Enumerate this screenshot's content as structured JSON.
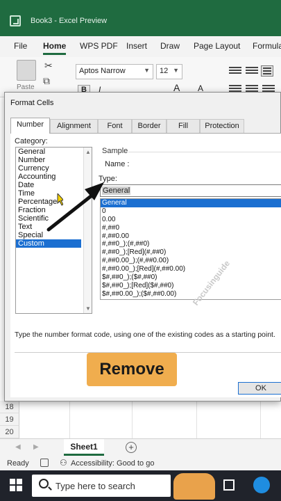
{
  "window": {
    "title": "Book3 - Excel Preview"
  },
  "ribbon_tabs": [
    "File",
    "Home",
    "WPS PDF",
    "Insert",
    "Draw",
    "Page Layout",
    "Formula"
  ],
  "ribbon": {
    "paste_label": "Paste",
    "font_name": "Aptos Narrow",
    "font_size": "12",
    "bold": "B",
    "italic": "I",
    "grow_font": "A",
    "shrink_font": "A"
  },
  "dialog": {
    "title": "Format Cells",
    "tabs": [
      "Number",
      "Alignment",
      "Font",
      "Border",
      "Fill",
      "Protection"
    ],
    "category_label": "Category:",
    "categories": [
      "General",
      "Number",
      "Currency",
      "Accounting",
      "Date",
      "Time",
      "Percentage",
      "Fraction",
      "Scientific",
      "Text",
      "Special",
      "Custom"
    ],
    "selected_category": "Custom",
    "sample_label": "Sample",
    "name_label": "Name :",
    "type_label": "Type:",
    "type_value": "General",
    "formats": [
      "General",
      "0",
      "0.00",
      "#,##0",
      "#,##0.00",
      "#,##0_);(#,##0)",
      "#,##0_);[Red](#,##0)",
      "#,##0.00_);(#,##0.00)",
      "#,##0.00_);[Red](#,##0.00)",
      "$#,##0_);($#,##0)",
      "$#,##0_);[Red]($#,##0)",
      "$#,##0.00_);($#,##0.00)"
    ],
    "hint": "Type the number format code, using one of the existing codes as a starting point.",
    "remove_label": "Remove",
    "ok_label": "OK",
    "watermark": "Focusinguide"
  },
  "sheet": {
    "row_numbers": [
      "18",
      "19",
      "20"
    ],
    "tab": "Sheet1",
    "add_sheet": "+"
  },
  "status": {
    "ready": "Ready",
    "accessibility": "Accessibility: Good to go"
  },
  "taskbar": {
    "search_placeholder": "Type here to search"
  },
  "colors": {
    "excel_green": "#1f6b40",
    "selection_blue": "#1b6fd1",
    "remove_orange": "#f0ad4e"
  }
}
